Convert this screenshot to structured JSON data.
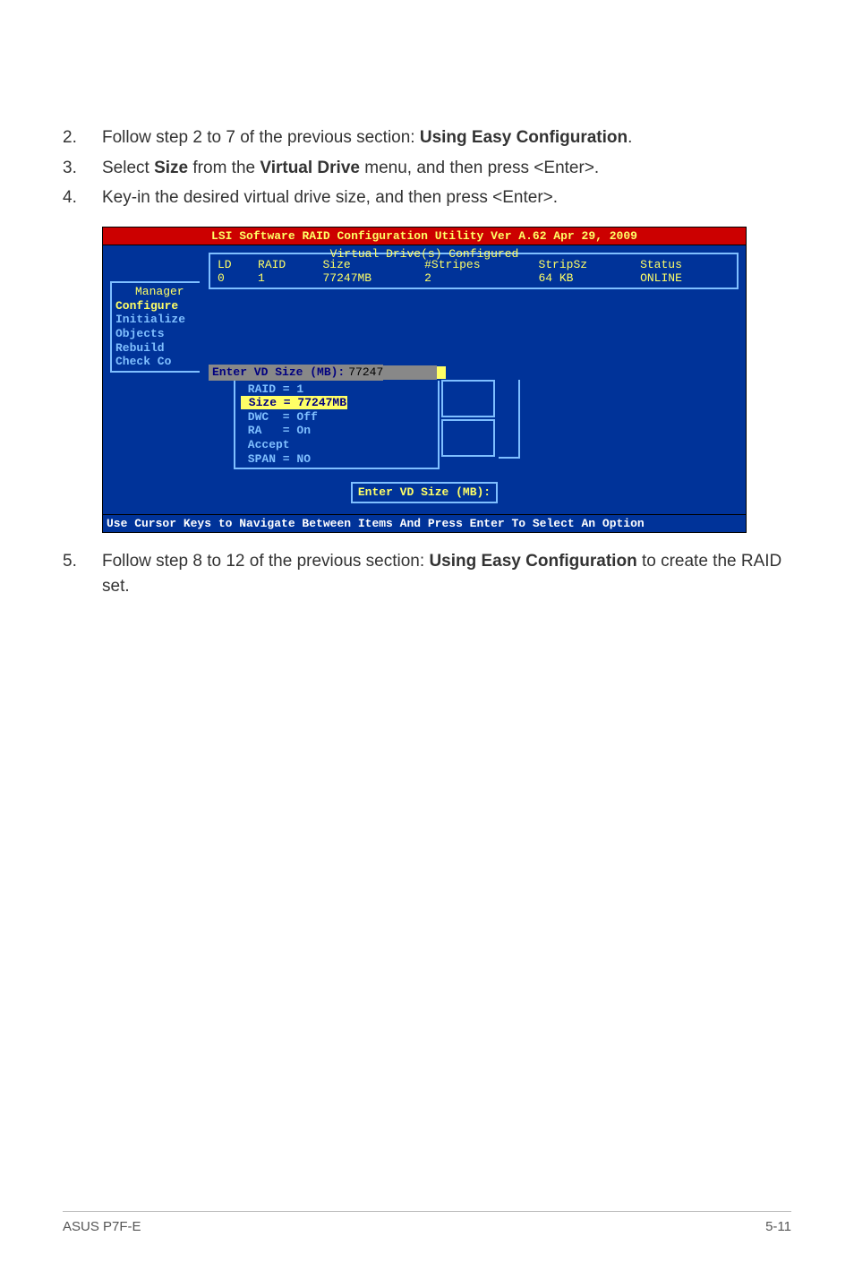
{
  "steps": {
    "s2_num": "2.",
    "s2_a": "Follow step 2 to 7 of the previous section: ",
    "s2_b": "Using Easy Configuration",
    "s2_c": ".",
    "s3_num": "3.",
    "s3_a": "Select ",
    "s3_b": "Size",
    "s3_c": " from the ",
    "s3_d": "Virtual Drive",
    "s3_e": " menu, and then press <Enter>.",
    "s4_num": "4.",
    "s4_a": "Key-in the desired virtual drive size, and then press <Enter>.",
    "s5_num": "5.",
    "s5_a": "Follow step 8 to 12 of the previous section: ",
    "s5_b": "Using Easy Configuration",
    "s5_c": " to create the RAID set."
  },
  "bios": {
    "title": "LSI Software RAID Configuration Utility Ver A.62 Apr 29, 2009",
    "vdc_label": "Virtual Drive(s) Configured",
    "headers": {
      "ld": "LD",
      "raid": "RAID",
      "size": "Size",
      "stripes": "#Stripes",
      "stripsz": "StripSz",
      "status": "Status"
    },
    "row": {
      "ld": "0",
      "raid": "1",
      "size": "77247MB",
      "stripes": "2",
      "stripsz": "64 KB",
      "status": "ONLINE"
    },
    "menu": {
      "manager": "Manager",
      "items": [
        "Configure",
        "Initialize",
        "Objects",
        "Rebuild",
        "Check Co"
      ]
    },
    "input": {
      "prompt": "Enter VD Size (MB):",
      "value": "77247"
    },
    "params": {
      "l1": " RAID = 1",
      "l2_a": " Size = 77247MB",
      "l3": " DWC  = Off",
      "l4": " RA   = On",
      "l5": " Accept",
      "l6": " SPAN = NO"
    },
    "help": "Enter VD Size (MB):",
    "footer": "Use Cursor Keys to Navigate Between Items And Press Enter To Select An Option"
  },
  "footer": {
    "left": "ASUS P7F-E",
    "right": "5-11"
  }
}
